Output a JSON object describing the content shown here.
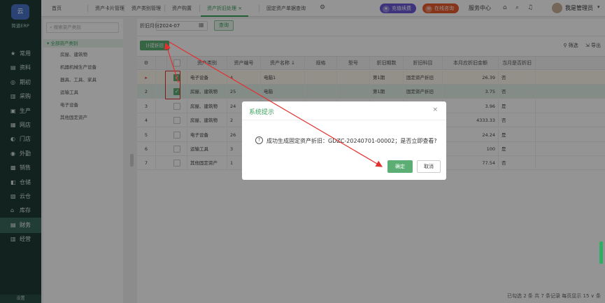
{
  "app": {
    "logo_text": "简道ERP",
    "logo_mark": "云"
  },
  "nav": {
    "items": [
      {
        "icon": "★",
        "label": "常用"
      },
      {
        "icon": "▤",
        "label": "资料"
      },
      {
        "icon": "◎",
        "label": "期初"
      },
      {
        "icon": "▥",
        "label": "采购"
      },
      {
        "icon": "▣",
        "label": "生产"
      },
      {
        "icon": "▦",
        "label": "网店"
      },
      {
        "icon": "◐",
        "label": "门店"
      },
      {
        "icon": "◉",
        "label": "外勤"
      },
      {
        "icon": "▩",
        "label": "销售"
      },
      {
        "icon": "◧",
        "label": "仓储"
      },
      {
        "icon": "▧",
        "label": "云仓"
      },
      {
        "icon": "⌂",
        "label": "库存"
      },
      {
        "icon": "▤",
        "label": "财务"
      },
      {
        "icon": "▥",
        "label": "经营"
      }
    ],
    "footer": "设置"
  },
  "tabs": [
    {
      "label": "首页"
    },
    {
      "label": "资产卡片管理"
    },
    {
      "label": "资产类别管理"
    },
    {
      "label": "资产购置"
    },
    {
      "label": "资产折旧处理 ×"
    },
    {
      "label": "固定资产单据查询"
    }
  ],
  "topbar": {
    "renew": "充值续费",
    "consult": "在线咨询",
    "service": "服务中心",
    "user": "我是管理员"
  },
  "tree": {
    "search_placeholder": "搜索资产类别",
    "root": "▾ 全部资产类别",
    "children": [
      "房屋、建筑物",
      "机器机械生产设备",
      "器具、工具、家具",
      "运输工具",
      "电子设备",
      "其他固定资产"
    ]
  },
  "filter": {
    "label": "折旧月份：",
    "month": "2024-07",
    "query": "查询"
  },
  "toolbar": {
    "calc": "计提折旧",
    "filter": "筛选",
    "export": "导出"
  },
  "table": {
    "headers": [
      "资产类别",
      "资产编号",
      "资产名称 ↓",
      "规格",
      "型号",
      "折旧期数",
      "折旧科目",
      "本月应折旧金额",
      "当月是否折旧"
    ],
    "rows": [
      {
        "no": "▸",
        "checked": true,
        "cat": "电子设备",
        "code": "4",
        "name": "电脑1",
        "spec": "",
        "model": "",
        "period": "第1期",
        "account": "固定资产折旧",
        "amount": "26.39",
        "dep": "否"
      },
      {
        "no": "2",
        "checked": true,
        "cat": "房屋、建筑物",
        "code": "25",
        "name": "电脑",
        "spec": "",
        "model": "",
        "period": "第1期",
        "account": "固定资产折旧",
        "amount": "3.75",
        "dep": "否"
      },
      {
        "no": "3",
        "checked": false,
        "cat": "房屋、建筑物",
        "code": "24",
        "name": "",
        "spec": "",
        "model": "",
        "period": "",
        "account": "",
        "amount": "3.96",
        "dep": "是"
      },
      {
        "no": "4",
        "checked": false,
        "cat": "房屋、建筑物",
        "code": "2",
        "name": "",
        "spec": "",
        "model": "",
        "period": "",
        "account": "",
        "amount": "4333.33",
        "dep": "否"
      },
      {
        "no": "5",
        "checked": false,
        "cat": "电子设备",
        "code": "26",
        "name": "",
        "spec": "",
        "model": "",
        "period": "",
        "account": "",
        "amount": "24.24",
        "dep": "是"
      },
      {
        "no": "6",
        "checked": false,
        "cat": "运输工具",
        "code": "3",
        "name": "",
        "spec": "",
        "model": "",
        "period": "",
        "account": "",
        "amount": "100",
        "dep": "是"
      },
      {
        "no": "7",
        "checked": false,
        "cat": "其他固定资产",
        "code": "1",
        "name": "",
        "spec": "",
        "model": "",
        "period": "",
        "account": "",
        "amount": "77.54",
        "dep": "否"
      }
    ]
  },
  "pager": "已勾选 2 条 共 7 条记录 每页显示 15 ∨ 条",
  "dialog": {
    "title": "系统提示",
    "message": "成功生成固定资产折旧：GDZC-20240701-00002；是否立即查看?",
    "ok": "确定",
    "cancel": "取消"
  },
  "colors": {
    "brand": "#3aa05c",
    "nav_bg": "#1f3d36",
    "arrow": "#e23030",
    "renew": "#6a5ad8",
    "consult": "#e85a2a"
  }
}
